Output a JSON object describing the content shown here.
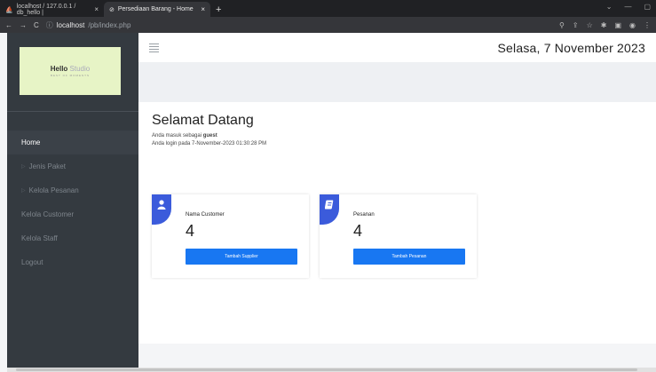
{
  "browser": {
    "tabs": [
      {
        "title": "localhost / 127.0.0.1 / db_hello |"
      },
      {
        "title": "Persediaan Barang - Home"
      }
    ],
    "url_host": "localhost",
    "url_path": "/pb/index.php"
  },
  "sidebar": {
    "logo_main": "Hello",
    "logo_accent": "Studio",
    "logo_tagline": "BEST OF MOMENTS",
    "items": [
      {
        "label": "Home"
      },
      {
        "label": "Jenis Paket"
      },
      {
        "label": "Kelola Pesanan"
      },
      {
        "label": "Kelola Customer"
      },
      {
        "label": "Kelola Staff"
      },
      {
        "label": "Logout"
      }
    ]
  },
  "header": {
    "date": "Selasa, 7 November 2023"
  },
  "welcome": {
    "title": "Selamat Datang",
    "line1_prefix": "Anda masuk sebagai",
    "line1_user": "guest",
    "line2": "Anda login pada 7-November-2023 01:30:28 PM"
  },
  "cards": [
    {
      "label": "Nama Customer",
      "value": "4",
      "button": "Tambah Supplier",
      "icon": "user-icon"
    },
    {
      "label": "Pesanan",
      "value": "4",
      "button": "Tambah Pesanan",
      "icon": "note-icon"
    }
  ],
  "colors": {
    "accent": "#3b5bdb",
    "button": "#1877f2",
    "sidebar": "#343a40"
  }
}
